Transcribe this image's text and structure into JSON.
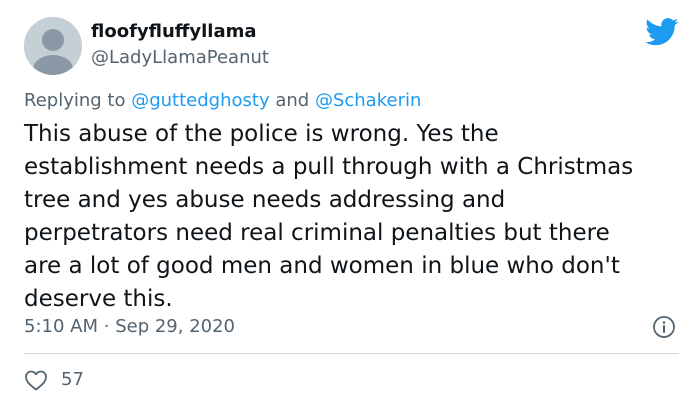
{
  "user": {
    "display_name": "floofyfluffyllama",
    "handle": "@LadyLlamaPeanut",
    "avatar_icon": "default-avatar-icon"
  },
  "brand": {
    "icon": "twitter-bird-icon",
    "color": "#1d9bf0"
  },
  "reply": {
    "prefix": "Replying to",
    "mention_1": "@guttedghosty",
    "conjunction": "and",
    "mention_2": "@Schakerin"
  },
  "tweet": {
    "lines": [
      "This abuse of the police is wrong. Yes the",
      "establishment needs a pull through with a Christmas",
      "tree and yes abuse needs addressing and",
      "perpetrators need real criminal penalties but there",
      "are a lot of good men and women in blue who don't",
      "deserve this."
    ]
  },
  "meta": {
    "time": "5:10 AM",
    "separator": "·",
    "date": "Sep 29, 2020",
    "info_icon": "info-icon"
  },
  "actions": {
    "like_icon": "heart-icon",
    "like_count": "57"
  }
}
